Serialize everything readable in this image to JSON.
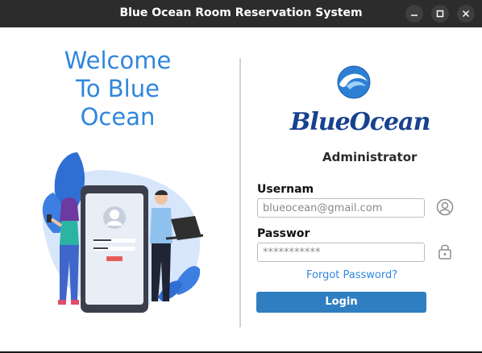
{
  "window": {
    "title": "Blue Ocean Room Reservation System",
    "controls": [
      "minimize-icon",
      "maximize-icon",
      "close-icon"
    ]
  },
  "welcome": {
    "lines": [
      "Welcome",
      "To Blue",
      "Ocean"
    ]
  },
  "logo": {
    "word1": "Blue",
    "word2": "Ocean"
  },
  "role": "Administrator",
  "form": {
    "username_label": "Usernam",
    "username_value": "blueocean@gmail.com",
    "password_label": "Passwor",
    "password_value": "***********",
    "forgot_link": "Forgot Password?",
    "login_button": "Login"
  },
  "icons": {
    "user": "user-circle-icon",
    "lock": "padlock-icon"
  },
  "colors": {
    "accent": "#2f86de",
    "button": "#2f7ec2",
    "logo_text": "#17428e",
    "titlebar": "#2c2c2c"
  }
}
